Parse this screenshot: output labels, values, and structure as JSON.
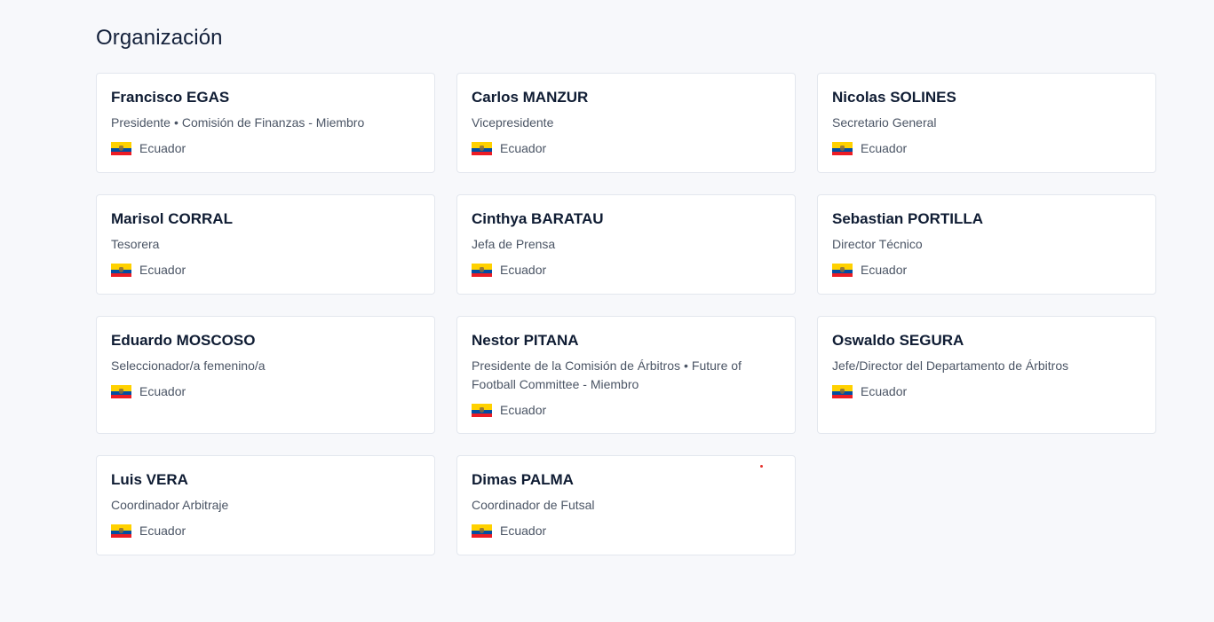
{
  "section": {
    "title": "Organización"
  },
  "colors": {
    "background": "#f7f8fb",
    "card": "#ffffff",
    "name": "#0f1c33",
    "role": "#4b5565"
  },
  "members": [
    {
      "name": "Francisco EGAS",
      "roles": [
        "Presidente",
        "Comisión de Finanzas - Miembro"
      ],
      "country": "Ecuador",
      "flag_icon": "ecuador-flag-icon"
    },
    {
      "name": "Carlos MANZUR",
      "roles": [
        "Vicepresidente"
      ],
      "country": "Ecuador",
      "flag_icon": "ecuador-flag-icon"
    },
    {
      "name": "Nicolas SOLINES",
      "roles": [
        "Secretario General"
      ],
      "country": "Ecuador",
      "flag_icon": "ecuador-flag-icon"
    },
    {
      "name": "Marisol CORRAL",
      "roles": [
        "Tesorera"
      ],
      "country": "Ecuador",
      "flag_icon": "ecuador-flag-icon"
    },
    {
      "name": "Cinthya BARATAU",
      "roles": [
        "Jefa de Prensa"
      ],
      "country": "Ecuador",
      "flag_icon": "ecuador-flag-icon"
    },
    {
      "name": "Sebastian PORTILLA",
      "roles": [
        "Director Técnico"
      ],
      "country": "Ecuador",
      "flag_icon": "ecuador-flag-icon"
    },
    {
      "name": "Eduardo MOSCOSO",
      "roles": [
        "Seleccionador/a femenino/a"
      ],
      "country": "Ecuador",
      "flag_icon": "ecuador-flag-icon"
    },
    {
      "name": "Nestor PITANA",
      "roles": [
        "Presidente de la Comisión de Árbitros",
        "Future of Football Committee - Miembro"
      ],
      "country": "Ecuador",
      "flag_icon": "ecuador-flag-icon"
    },
    {
      "name": "Oswaldo SEGURA",
      "roles": [
        "Jefe/Director del Departamento de Árbitros"
      ],
      "country": "Ecuador",
      "flag_icon": "ecuador-flag-icon"
    },
    {
      "name": "Luis VERA",
      "roles": [
        "Coordinador Arbitraje"
      ],
      "country": "Ecuador",
      "flag_icon": "ecuador-flag-icon"
    },
    {
      "name": "Dimas PALMA",
      "roles": [
        "Coordinador de Futsal"
      ],
      "country": "Ecuador",
      "flag_icon": "ecuador-flag-icon"
    }
  ]
}
